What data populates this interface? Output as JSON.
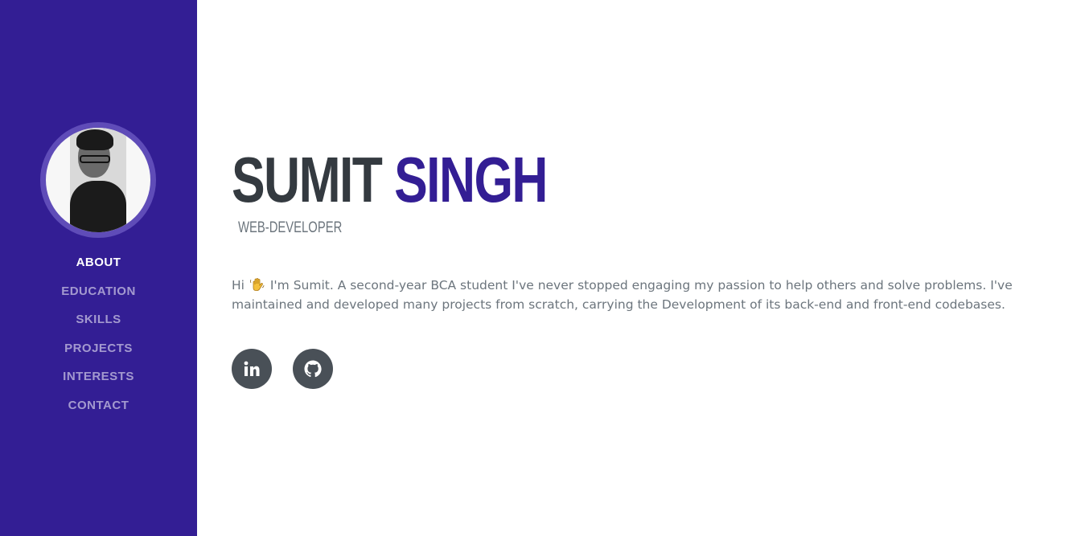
{
  "sidebar": {
    "background": "#331e94",
    "avatar_alt": "profile photo",
    "nav": [
      {
        "label": "ABOUT",
        "active": true
      },
      {
        "label": "EDUCATION",
        "active": false
      },
      {
        "label": "SKILLS",
        "active": false
      },
      {
        "label": "PROJECTS",
        "active": false
      },
      {
        "label": "INTERESTS",
        "active": false
      },
      {
        "label": "CONTACT",
        "active": false
      }
    ]
  },
  "about": {
    "first_name": "SUMIT",
    "last_name": "SINGH",
    "subheading": "WEB-DEVELOPER",
    "bio_before_emoji": "Hi",
    "bio_emoji": "waving-hand",
    "bio_after_emoji": "I'm Sumit. A second-year BCA student I've never stopped engaging my passion to help others and solve problems. I've maintained and developed many projects from scratch, carrying the Development of its back-end and front-end codebases.",
    "socials": [
      {
        "icon": "linkedin-icon"
      },
      {
        "icon": "github-icon"
      }
    ]
  },
  "colors": {
    "primary": "#331e94",
    "name_dark": "#343a40",
    "muted_text": "#6c757d",
    "social_bg": "#495057"
  }
}
